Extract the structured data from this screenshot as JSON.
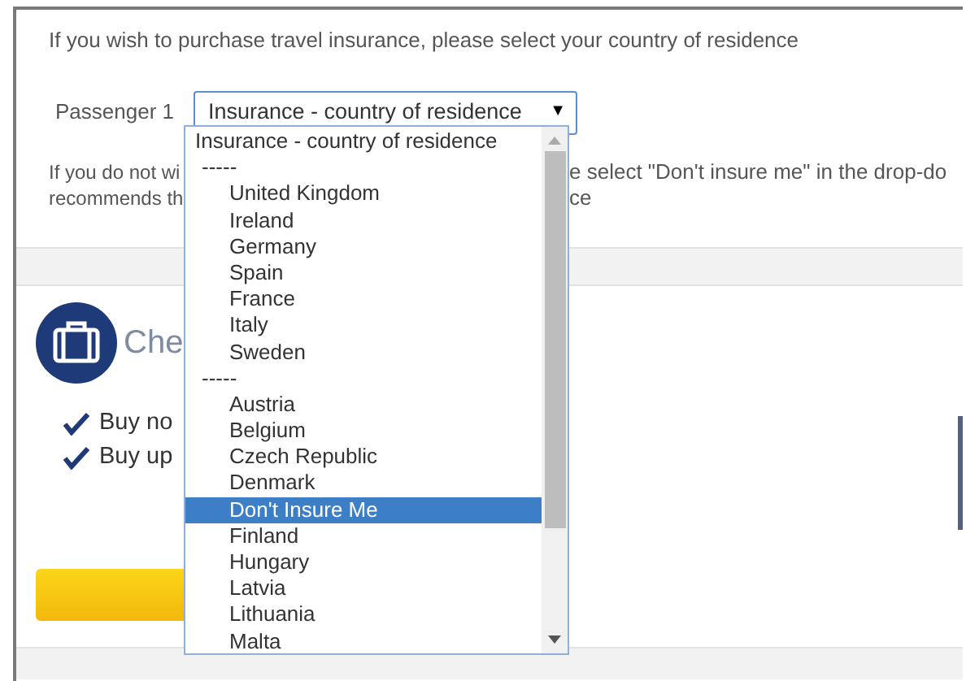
{
  "intro": "If you wish to purchase travel insurance, please select your country of residence",
  "passenger": {
    "label": "Passenger 1",
    "select": {
      "value": "Insurance - country of residence",
      "arrow": "▼",
      "expanded": true
    }
  },
  "note": {
    "left_lines": [
      "If you do not wi",
      "recommends th"
    ],
    "right_lines": [
      "e select \"Don't insure me\" in the drop-do",
      "ce"
    ]
  },
  "dropdown": {
    "options": [
      {
        "kind": "header",
        "label": "Insurance - country of residence",
        "selected": false
      },
      {
        "kind": "separator",
        "label": "-----",
        "selected": false
      },
      {
        "kind": "country",
        "label": "United Kingdom",
        "selected": false
      },
      {
        "kind": "country",
        "label": "Ireland",
        "selected": false
      },
      {
        "kind": "country",
        "label": "Germany",
        "selected": false
      },
      {
        "kind": "country",
        "label": "Spain",
        "selected": false
      },
      {
        "kind": "country",
        "label": "France",
        "selected": false
      },
      {
        "kind": "country",
        "label": "Italy",
        "selected": false
      },
      {
        "kind": "country",
        "label": "Sweden",
        "selected": false
      },
      {
        "kind": "separator",
        "label": "-----",
        "selected": false
      },
      {
        "kind": "country",
        "label": "Austria",
        "selected": false
      },
      {
        "kind": "country",
        "label": "Belgium",
        "selected": false
      },
      {
        "kind": "country",
        "label": "Czech Republic",
        "selected": false
      },
      {
        "kind": "country",
        "label": "Denmark",
        "selected": false
      },
      {
        "kind": "country",
        "label": "Don't Insure Me",
        "selected": true
      },
      {
        "kind": "country",
        "label": "Finland",
        "selected": false
      },
      {
        "kind": "country",
        "label": "Hungary",
        "selected": false
      },
      {
        "kind": "country",
        "label": "Latvia",
        "selected": false
      },
      {
        "kind": "country",
        "label": "Lithuania",
        "selected": false
      },
      {
        "kind": "country",
        "label": "Malta",
        "selected": false
      }
    ]
  },
  "offer": {
    "title": "Che",
    "benefits": [
      "Buy no",
      "Buy up"
    ]
  }
}
